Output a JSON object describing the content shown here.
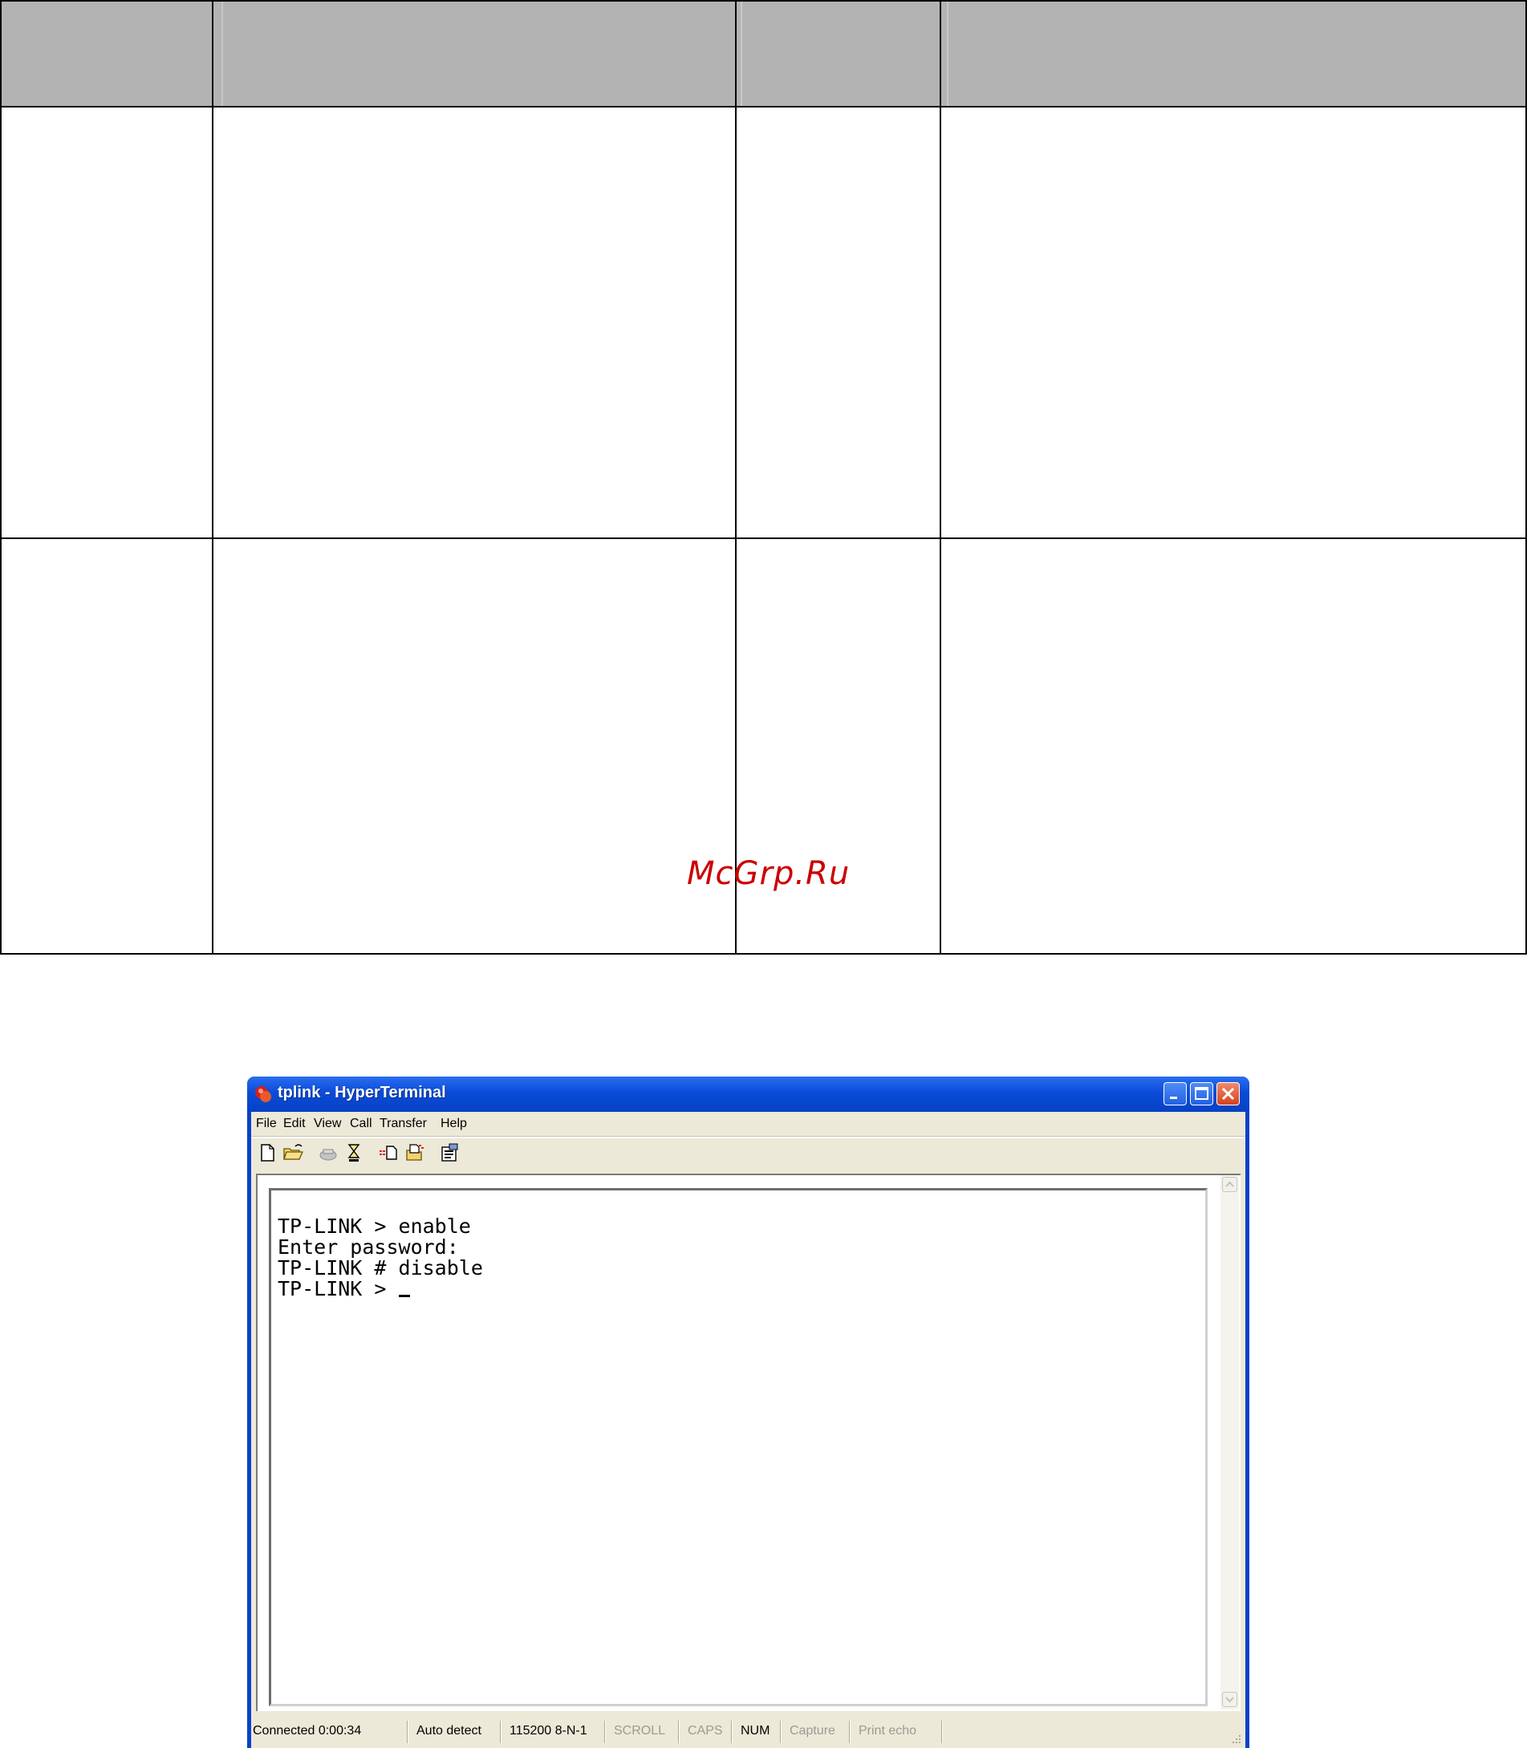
{
  "document": {
    "watermark": "McGrp.Ru"
  },
  "window": {
    "title": "tplink - HyperTerminal",
    "controls": {
      "minimize": "minimize",
      "maximize": "maximize",
      "close": "close"
    }
  },
  "menubar": {
    "items": [
      "File",
      "Edit",
      "View",
      "Call",
      "Transfer",
      "Help"
    ]
  },
  "toolbar": {
    "icons": [
      "new-connection-icon",
      "open-icon",
      "call-icon",
      "disconnect-icon",
      "send-icon",
      "receive-icon",
      "properties-icon"
    ]
  },
  "terminal": {
    "lines": [
      "TP-LINK > enable",
      "Enter password:",
      "TP-LINK # disable",
      "TP-LINK > "
    ]
  },
  "statusbar": {
    "connected": "Connected 0:00:34",
    "detect": "Auto detect",
    "port": "115200 8-N-1",
    "scroll": "SCROLL",
    "caps": "CAPS",
    "num": "NUM",
    "capture": "Capture",
    "print_echo": "Print echo"
  },
  "colors": {
    "title_blue": "#0a4cd8",
    "header_gray": "#b3b3b3",
    "watermark_red": "#cc0000"
  }
}
